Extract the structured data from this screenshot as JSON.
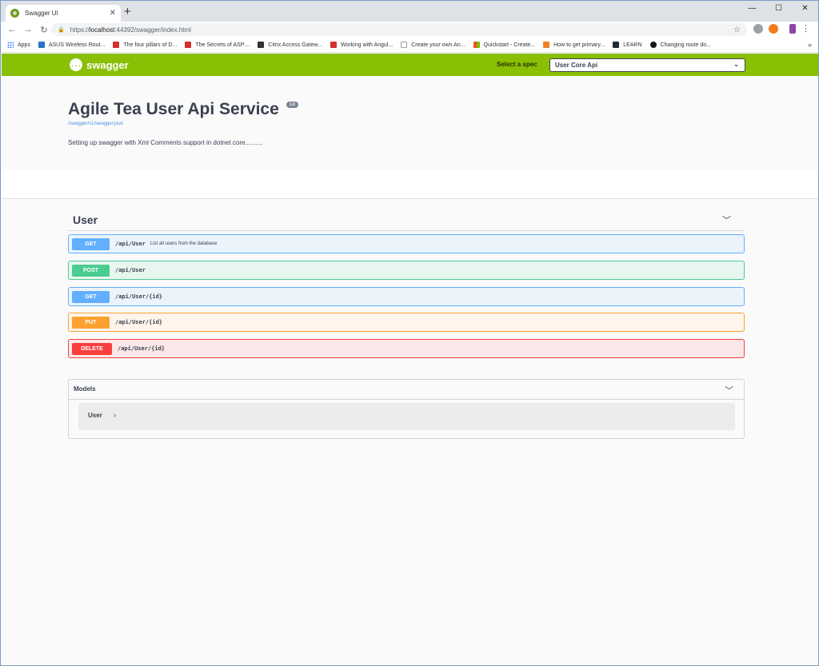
{
  "browser": {
    "tab_title": "Swagger UI",
    "tab_close": "✕",
    "new_tab": "+",
    "url_scheme": "https://",
    "url_host": "localhost",
    "url_path": ":44392/swagger/index.html",
    "bookmarks": [
      {
        "label": "Apps",
        "color": "#4285f4"
      },
      {
        "label": "ASUS Wireless Rout...",
        "color": "#2a73c5"
      },
      {
        "label": "The four pillars of D...",
        "color": "#d32f2f"
      },
      {
        "label": "The Secrets of ASP....",
        "color": "#d32f2f"
      },
      {
        "label": "Citrix Access Gatew...",
        "color": "#333333"
      },
      {
        "label": "Working with Angul...",
        "color": "#d32f2f"
      },
      {
        "label": "Create your own An...",
        "color": "#9e9e9e"
      },
      {
        "label": "Quickstart - Create...",
        "color": "#f25022"
      },
      {
        "label": "How to get primary...",
        "color": "#f48024"
      },
      {
        "label": "LEARN",
        "color": "#1e2a3a"
      },
      {
        "label": "Changing route do...",
        "color": "#181717"
      }
    ],
    "bookmarks_more": "»"
  },
  "swagger": {
    "logo_mark": "{...}",
    "logo_text": "swagger",
    "spec_label": "Select a spec",
    "spec_value": "User Core Api"
  },
  "info": {
    "title": "Agile Tea User Api Service",
    "version": "1.0",
    "spec_url": "/swagger/v1/swagger.json",
    "description": "Setting up swagger with Xml Comments support in dotnet core.........."
  },
  "section": {
    "title": "User",
    "operations": [
      {
        "method": "GET",
        "path": "/api/User",
        "summary": "List all users from the database"
      },
      {
        "method": "POST",
        "path": "/api/User",
        "summary": ""
      },
      {
        "method": "GET",
        "path": "/api/User/{id}",
        "summary": ""
      },
      {
        "method": "PUT",
        "path": "/api/User/{id}",
        "summary": ""
      },
      {
        "method": "DELETE",
        "path": "/api/User/{id}",
        "summary": ""
      }
    ]
  },
  "models": {
    "title": "Models",
    "items": [
      {
        "name": "User"
      }
    ]
  }
}
